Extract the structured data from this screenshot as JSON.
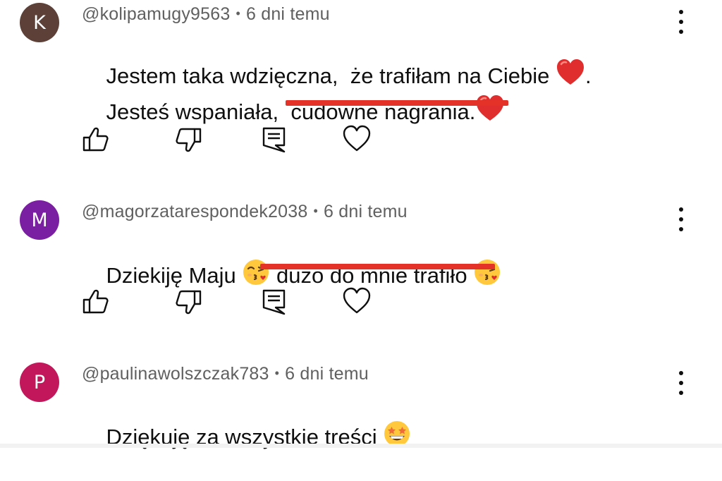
{
  "comments": [
    {
      "avatar_letter": "K",
      "avatar_color": "#5d4037",
      "author": "@kolipamugy9563",
      "time": "6 dni temu",
      "line1": "Jestem taka wdzięczna,  że trafiłam na Ciebie ",
      "line1_end": ".",
      "line2_start": "Jesteś wspaniała,  ",
      "line2_highlight": "cudowne nagrania.",
      "emoji": "heart"
    },
    {
      "avatar_letter": "M",
      "avatar_color": "#7b1fa2",
      "author": "@magorzatarespondek2038",
      "time": "6 dni temu",
      "line1_start": "Dziekiję Maju ",
      "line1_highlight": " dużo do mnie trafiło ",
      "emoji": "kiss"
    },
    {
      "avatar_letter": "P",
      "avatar_color": "#c2185b",
      "author": "@paulinawolszczak783",
      "time": "6 dni temu",
      "line1": "Dziękuję za wszystkie treści ",
      "emoji": "star-struck"
    }
  ],
  "separator": "•",
  "colors": {
    "underline": "#e53228",
    "meta_text": "#606060",
    "body_text": "#0f0f0f"
  },
  "icons": [
    "like-icon",
    "dislike-icon",
    "reply-icon",
    "heart-icon",
    "more-vert-icon"
  ]
}
